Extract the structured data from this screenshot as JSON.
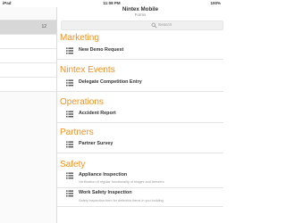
{
  "status_bar": {
    "time": "11:08 PM",
    "left": "iPad",
    "right": "100%"
  },
  "left_pane": {
    "rows": [
      {
        "count": "12",
        "selected": true
      },
      {
        "count": "",
        "selected": false
      },
      {
        "count": "",
        "selected": false
      },
      {
        "count": "",
        "selected": false
      },
      {
        "count": "",
        "selected": false
      }
    ]
  },
  "header": {
    "title": "Nintex Mobile",
    "subtitle": "Forms"
  },
  "search": {
    "placeholder": "Search"
  },
  "sections": [
    {
      "title": "Marketing",
      "forms": [
        {
          "name": "New Demo Request",
          "description": ""
        }
      ]
    },
    {
      "title": "Nintex Events",
      "forms": [
        {
          "name": "Delegate Competition Entry",
          "description": ""
        }
      ]
    },
    {
      "title": "Operations",
      "forms": [
        {
          "name": "Accident Report",
          "description": ""
        }
      ]
    },
    {
      "title": "Partners",
      "forms": [
        {
          "name": "Partner Survey",
          "description": ""
        }
      ]
    },
    {
      "title": "Safety",
      "forms": [
        {
          "name": "Appliance Inspection",
          "description": "Verification of regular functionality of fridges and freezers"
        },
        {
          "name": "Work Safety Inspection",
          "description": "Safety inspection form for defective items in you building"
        }
      ]
    }
  ],
  "colors": {
    "section_title": "#f4901e",
    "selected_row": "#d7d7d7"
  },
  "icons": {
    "form": "form-list-icon",
    "search": "search-icon"
  }
}
